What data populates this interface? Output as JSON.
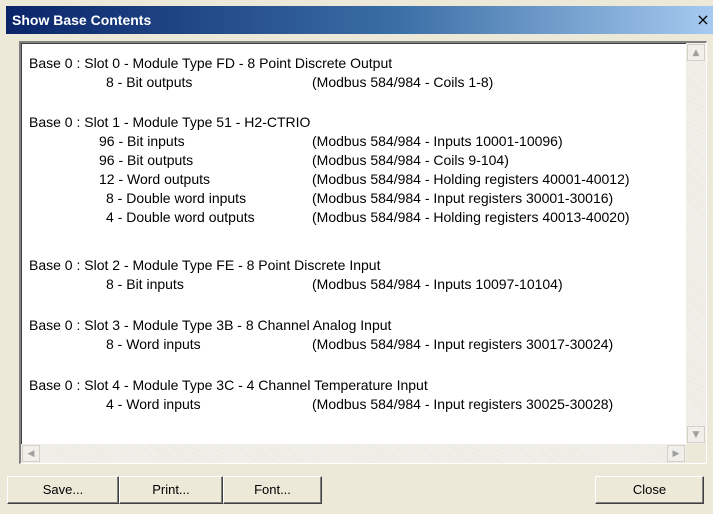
{
  "window": {
    "title": "Show Base Contents",
    "close_glyph": "×"
  },
  "modules": [
    {
      "header": "Base 0 : Slot 0 - Module Type FD - 8 Point Discrete Output",
      "rows": [
        {
          "label": "8 - Bit outputs",
          "desc": "(Modbus 584/984 - Coils 1-8)"
        }
      ]
    },
    {
      "header": "Base 0 : Slot 1 - Module Type 51 - H2-CTRIO",
      "rows": [
        {
          "label": "96 - Bit inputs",
          "desc": "(Modbus 584/984 - Inputs 10001-10096)"
        },
        {
          "label": "96 - Bit outputs",
          "desc": "(Modbus 584/984 - Coils 9-104)"
        },
        {
          "label": "12 - Word outputs",
          "desc": "(Modbus 584/984 - Holding registers 40001-40012)"
        },
        {
          "label": "8 - Double word inputs",
          "desc": "(Modbus 584/984 - Input registers 30001-30016)"
        },
        {
          "label": "4 - Double word outputs",
          "desc": "(Modbus 584/984 - Holding registers 40013-40020)"
        }
      ]
    },
    {
      "header": "Base 0 : Slot 2 - Module Type FE - 8 Point Discrete Input",
      "rows": [
        {
          "label": "8 - Bit inputs",
          "desc": "(Modbus 584/984 - Inputs 10097-10104)"
        }
      ]
    },
    {
      "header": "Base 0 : Slot 3 - Module Type 3B - 8 Channel Analog Input",
      "rows": [
        {
          "label": "8 - Word inputs",
          "desc": "(Modbus 584/984 - Input registers 30017-30024)"
        }
      ]
    },
    {
      "header": "Base 0 : Slot 4 - Module Type 3C - 4 Channel Temperature Input",
      "rows": [
        {
          "label": "4 - Word inputs",
          "desc": "(Modbus 584/984 - Input registers 30025-30028)"
        }
      ]
    }
  ],
  "scrollbars": {
    "up_glyph": "▲",
    "down_glyph": "▼",
    "left_glyph": "◀",
    "right_glyph": "▶"
  },
  "buttons": {
    "save": "Save...",
    "print": "Print...",
    "font": "Font...",
    "close": "Close"
  }
}
